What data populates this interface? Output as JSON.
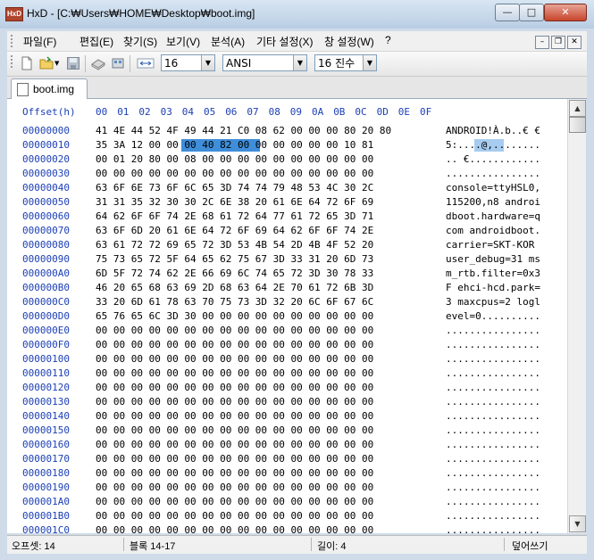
{
  "window": {
    "title": "HxD - [C:₩Users₩HOME₩Desktop₩boot.img]",
    "app_icon_text": "HxD"
  },
  "menu": [
    "파일(F)",
    "편집(E)",
    "찾기(S)",
    "보기(V)",
    "분석(A)",
    "기타 설정(X)",
    "창 설정(W)",
    "?"
  ],
  "toolbar": {
    "bytes_per_row": "16",
    "charset": "ANSI",
    "offset_base": "16 진수"
  },
  "tab": {
    "label": "boot.img"
  },
  "hex": {
    "header_offset": "Offset(h)",
    "header_cols": [
      "00",
      "01",
      "02",
      "03",
      "04",
      "05",
      "06",
      "07",
      "08",
      "09",
      "0A",
      "0B",
      "0C",
      "0D",
      "0E",
      "0F"
    ],
    "rows": [
      {
        "offset": "00000000",
        "bytes": "41 4E 44 52 4F 49 44 21 C0 08 62 00 00 00 80 20 80",
        "ascii": "ANDROID!À.b..€ €"
      },
      {
        "offset": "00000010",
        "bytes": "35 3A 12 00 00 00 40 82 00 00 00 00 00 00 10 81",
        "ascii": "5:....@,........"
      },
      {
        "offset": "00000020",
        "bytes": "00 01 20 80 00 08 00 00 00 00 00 00 00 00 00 00",
        "ascii": ".. €............"
      },
      {
        "offset": "00000030",
        "bytes": "00 00 00 00 00 00 00 00 00 00 00 00 00 00 00 00",
        "ascii": "................"
      },
      {
        "offset": "00000040",
        "bytes": "63 6F 6E 73 6F 6C 65 3D 74 74 79 48 53 4C 30 2C",
        "ascii": "console=ttyHSL0,"
      },
      {
        "offset": "00000050",
        "bytes": "31 31 35 32 30 30 2C 6E 38 20 61 6E 64 72 6F 69",
        "ascii": "115200,n8 androi"
      },
      {
        "offset": "00000060",
        "bytes": "64 62 6F 6F 74 2E 68 61 72 64 77 61 72 65 3D 71",
        "ascii": "dboot.hardware=q"
      },
      {
        "offset": "00000070",
        "bytes": "63 6F 6D 20 61 6E 64 72 6F 69 64 62 6F 6F 74 2E",
        "ascii": "com androidboot."
      },
      {
        "offset": "00000080",
        "bytes": "63 61 72 72 69 65 72 3D 53 4B 54 2D 4B 4F 52 20",
        "ascii": "carrier=SKT-KOR "
      },
      {
        "offset": "00000090",
        "bytes": "75 73 65 72 5F 64 65 62 75 67 3D 33 31 20 6D 73",
        "ascii": "user_debug=31 ms"
      },
      {
        "offset": "000000A0",
        "bytes": "6D 5F 72 74 62 2E 66 69 6C 74 65 72 3D 30 78 33",
        "ascii": "m_rtb.filter=0x3"
      },
      {
        "offset": "000000B0",
        "bytes": "46 20 65 68 63 69 2D 68 63 64 2E 70 61 72 6B 3D",
        "ascii": "F ehci-hcd.park="
      },
      {
        "offset": "000000C0",
        "bytes": "33 20 6D 61 78 63 70 75 73 3D 32 20 6C 6F 67 6C",
        "ascii": "3 maxcpus=2 logl"
      },
      {
        "offset": "000000D0",
        "bytes": "65 76 65 6C 3D 30 00 00 00 00 00 00 00 00 00 00",
        "ascii": "evel=0.........."
      },
      {
        "offset": "000000E0",
        "bytes": "00 00 00 00 00 00 00 00 00 00 00 00 00 00 00 00",
        "ascii": "................"
      },
      {
        "offset": "000000F0",
        "bytes": "00 00 00 00 00 00 00 00 00 00 00 00 00 00 00 00",
        "ascii": "................"
      },
      {
        "offset": "00000100",
        "bytes": "00 00 00 00 00 00 00 00 00 00 00 00 00 00 00 00",
        "ascii": "................"
      },
      {
        "offset": "00000110",
        "bytes": "00 00 00 00 00 00 00 00 00 00 00 00 00 00 00 00",
        "ascii": "................"
      },
      {
        "offset": "00000120",
        "bytes": "00 00 00 00 00 00 00 00 00 00 00 00 00 00 00 00",
        "ascii": "................"
      },
      {
        "offset": "00000130",
        "bytes": "00 00 00 00 00 00 00 00 00 00 00 00 00 00 00 00",
        "ascii": "................"
      },
      {
        "offset": "00000140",
        "bytes": "00 00 00 00 00 00 00 00 00 00 00 00 00 00 00 00",
        "ascii": "................"
      },
      {
        "offset": "00000150",
        "bytes": "00 00 00 00 00 00 00 00 00 00 00 00 00 00 00 00",
        "ascii": "................"
      },
      {
        "offset": "00000160",
        "bytes": "00 00 00 00 00 00 00 00 00 00 00 00 00 00 00 00",
        "ascii": "................"
      },
      {
        "offset": "00000170",
        "bytes": "00 00 00 00 00 00 00 00 00 00 00 00 00 00 00 00",
        "ascii": "................"
      },
      {
        "offset": "00000180",
        "bytes": "00 00 00 00 00 00 00 00 00 00 00 00 00 00 00 00",
        "ascii": "................"
      },
      {
        "offset": "00000190",
        "bytes": "00 00 00 00 00 00 00 00 00 00 00 00 00 00 00 00",
        "ascii": "................"
      },
      {
        "offset": "000001A0",
        "bytes": "00 00 00 00 00 00 00 00 00 00 00 00 00 00 00 00",
        "ascii": "................"
      },
      {
        "offset": "000001B0",
        "bytes": "00 00 00 00 00 00 00 00 00 00 00 00 00 00 00 00",
        "ascii": "................"
      },
      {
        "offset": "000001C0",
        "bytes": "00 00 00 00 00 00 00 00 00 00 00 00 00 00 00 00",
        "ascii": "................"
      }
    ],
    "selection": {
      "bytes": "00 00 40 82",
      "ascii": "..@,"
    }
  },
  "status": {
    "offset": "오프셋: 14",
    "block": "블록 14-17",
    "length": "길이: 4",
    "mode": "덮어쓰기"
  },
  "colors": {
    "offset_blue": "#1c3fb5",
    "selection_bg": "#3f8ed9",
    "selection_ascii_bg": "#a7ccef"
  }
}
